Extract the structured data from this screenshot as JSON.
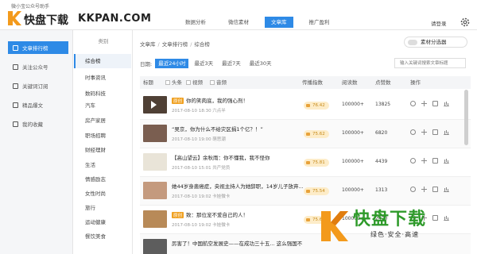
{
  "app": {
    "title": "微小宝公众号助手",
    "logo_text": "快盘下载",
    "logo_url": "KKPAN.COM",
    "login": "请登录"
  },
  "topnav": [
    {
      "label": "数据分析",
      "active": false
    },
    {
      "label": "微信素材",
      "active": false
    },
    {
      "label": "文章库",
      "active": true
    },
    {
      "label": "推广盈利",
      "active": false
    }
  ],
  "sidebar": [
    {
      "label": "文章排行榜",
      "active": true
    },
    {
      "label": "关注公众号",
      "active": false
    },
    {
      "label": "关键词订阅",
      "active": false
    },
    {
      "label": "精品爆文",
      "active": false
    },
    {
      "label": "我的收藏",
      "active": false
    }
  ],
  "categories": {
    "header": "类别",
    "items": [
      {
        "label": "综合榜",
        "active": true
      },
      {
        "label": "时事资讯",
        "active": false
      },
      {
        "label": "数码科技",
        "active": false
      },
      {
        "label": "汽车",
        "active": false
      },
      {
        "label": "房产家居",
        "active": false
      },
      {
        "label": "职场招聘",
        "active": false
      },
      {
        "label": "财经理财",
        "active": false
      },
      {
        "label": "生活",
        "active": false
      },
      {
        "label": "情感励志",
        "active": false
      },
      {
        "label": "女性时尚",
        "active": false
      },
      {
        "label": "旅行",
        "active": false
      },
      {
        "label": "运动健康",
        "active": false
      },
      {
        "label": "餐饮美食",
        "active": false
      }
    ]
  },
  "breadcrumb": [
    "文章库",
    "文章排行榜",
    "综合榜"
  ],
  "filter_button": "素材分选器",
  "date_filter": {
    "label": "日期:",
    "options": [
      {
        "label": "最近24小时",
        "active": true
      },
      {
        "label": "最近3天",
        "active": false
      },
      {
        "label": "最近7天",
        "active": false
      },
      {
        "label": "最近30天",
        "active": false
      }
    ]
  },
  "search": {
    "placeholder": "输入关键词搜索文章标题"
  },
  "table": {
    "headers": {
      "title": "标题",
      "head": "头条",
      "video": "视频",
      "audio": "音频",
      "score": "传播指数",
      "reads": "阅读数",
      "likes": "点赞数",
      "actions": "操作"
    },
    "rows": [
      {
        "tag": "原创",
        "title": "你的笑肉底，我的强心剂！",
        "meta": "2017-08-10 18:30  六点半",
        "score": "76.42",
        "reads": "100000+",
        "likes": "13825",
        "thumb_color": "#5a4a3a",
        "video": true
      },
      {
        "tag": "",
        "title": "“吴京，你为什么不给灾区捐1个亿？！”",
        "meta": "2017-08-10 19:00  萌思潮",
        "score": "75.62",
        "reads": "100000+",
        "likes": "6820",
        "thumb_color": "#7a5e50",
        "video": false
      },
      {
        "tag": "",
        "title": "【高山望云】余秋雨：你不懂我，我不怪你",
        "meta": "2017-08-10 15:01  共产党员",
        "score": "75.81",
        "reads": "100000+",
        "likes": "4439",
        "thumb_color": "#9a7a50",
        "video": false
      },
      {
        "tag": "",
        "title": "她44岁身患癌症，央视主持人为她辞职，14岁儿子放弃...",
        "meta": "2017-08-10 19:02  卡娃微卡",
        "score": "75.54",
        "reads": "100000+",
        "likes": "1313",
        "thumb_color": "#b07a60",
        "video": false
      },
      {
        "tag": "原创",
        "title": "致：那位宠不爱自己的人！",
        "meta": "2017-08-10 19:02  卡娃微卡",
        "score": "75.64",
        "reads": "100000+",
        "likes": "2470",
        "thumb_color": "#c09060",
        "video": false
      },
      {
        "tag": "",
        "title": "厉害了！中国航空发展史——在成功三十五...  这么强国不",
        "meta": "",
        "score": "",
        "reads": "",
        "likes": "",
        "thumb_color": "#6a6a6a",
        "video": false
      }
    ]
  },
  "watermark": {
    "main": "快盘下载",
    "sub": "绿色·安全·高速"
  },
  "colors": {
    "accent": "#2e8ae6",
    "tag": "#f0a020",
    "watermark_green": "#2e9a2a"
  }
}
